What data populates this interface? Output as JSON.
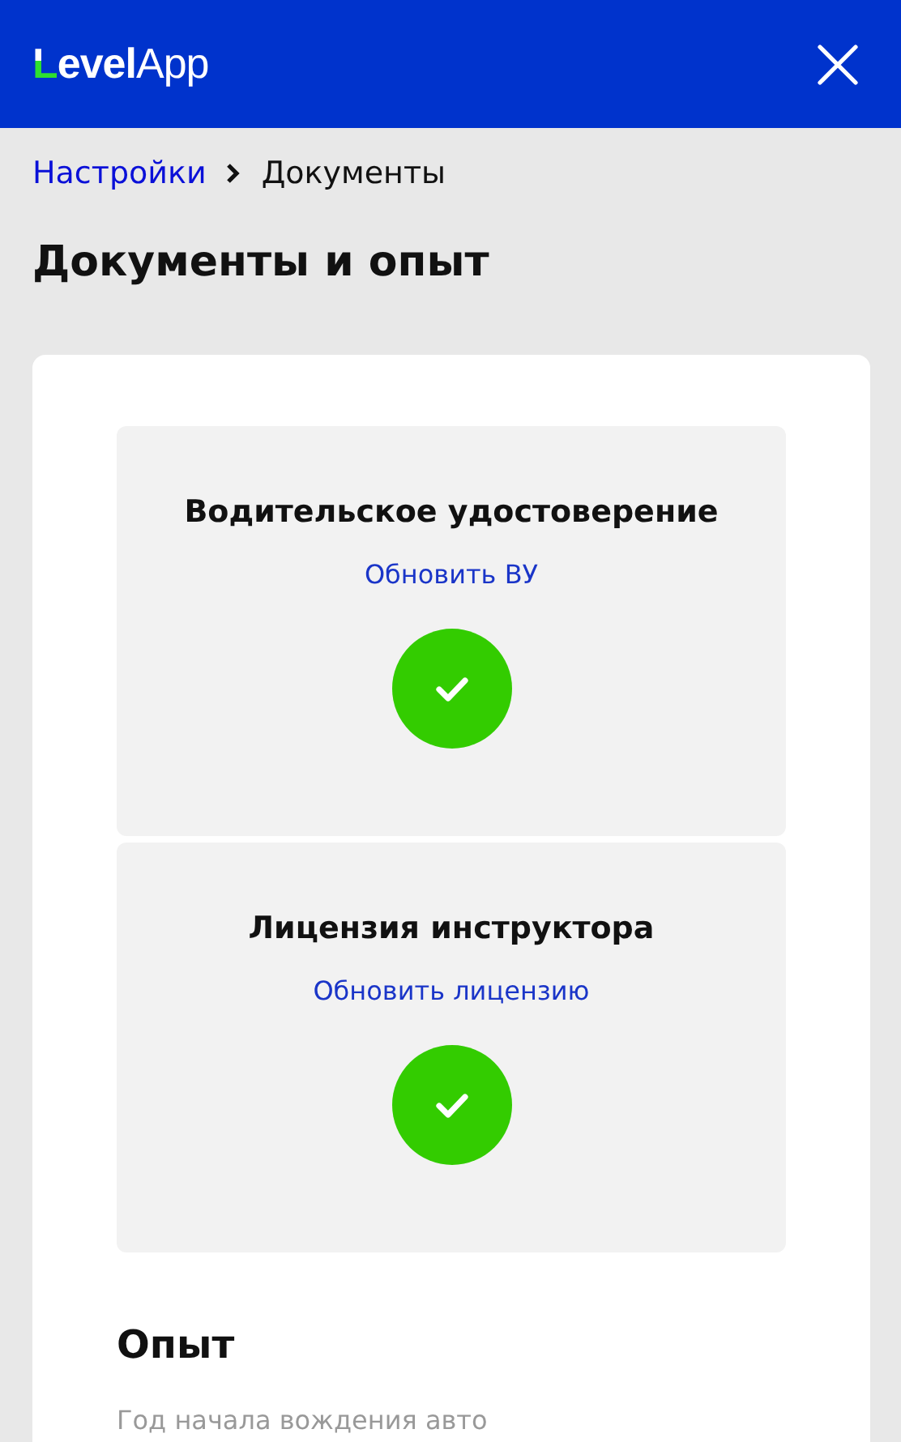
{
  "header": {
    "logo": {
      "bold": "Level",
      "light": "App"
    }
  },
  "breadcrumb": {
    "items": [
      {
        "label": "Настройки",
        "link": true
      },
      {
        "label": "Документы",
        "link": false
      }
    ]
  },
  "title": "Документы и опыт",
  "documents": [
    {
      "title": "Водительское удостоверение",
      "action": "Обновить ВУ",
      "verified": true
    },
    {
      "title": "Лицензия инструктора",
      "action": "Обновить лицензию",
      "verified": true
    }
  ],
  "experience": {
    "heading": "Опыт",
    "field_label": "Год начала вождения авто"
  }
}
